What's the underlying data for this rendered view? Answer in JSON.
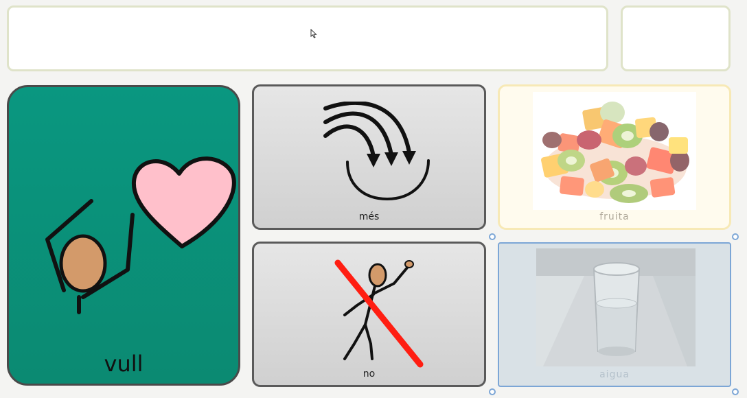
{
  "sentence_bar": {
    "text": ""
  },
  "cells": {
    "vull": {
      "label": "vull",
      "icon": "want-icon"
    },
    "mes": {
      "label": "més",
      "icon": "more-icon"
    },
    "no": {
      "label": "no",
      "icon": "no-icon"
    },
    "fruita": {
      "label": "fruita",
      "icon": "fruit-photo"
    },
    "aigua": {
      "label": "aigua",
      "icon": "water-glass-photo",
      "selected": true
    }
  },
  "colors": {
    "vull_background": "#0b8a72",
    "grey_cell": "#d8d8d8",
    "fruita_border": "#f7e9b6",
    "selection": "#7ca6d6",
    "heart": "#ffc0cb",
    "head": "#d39a6a",
    "no_cross": "#ff1e12"
  }
}
